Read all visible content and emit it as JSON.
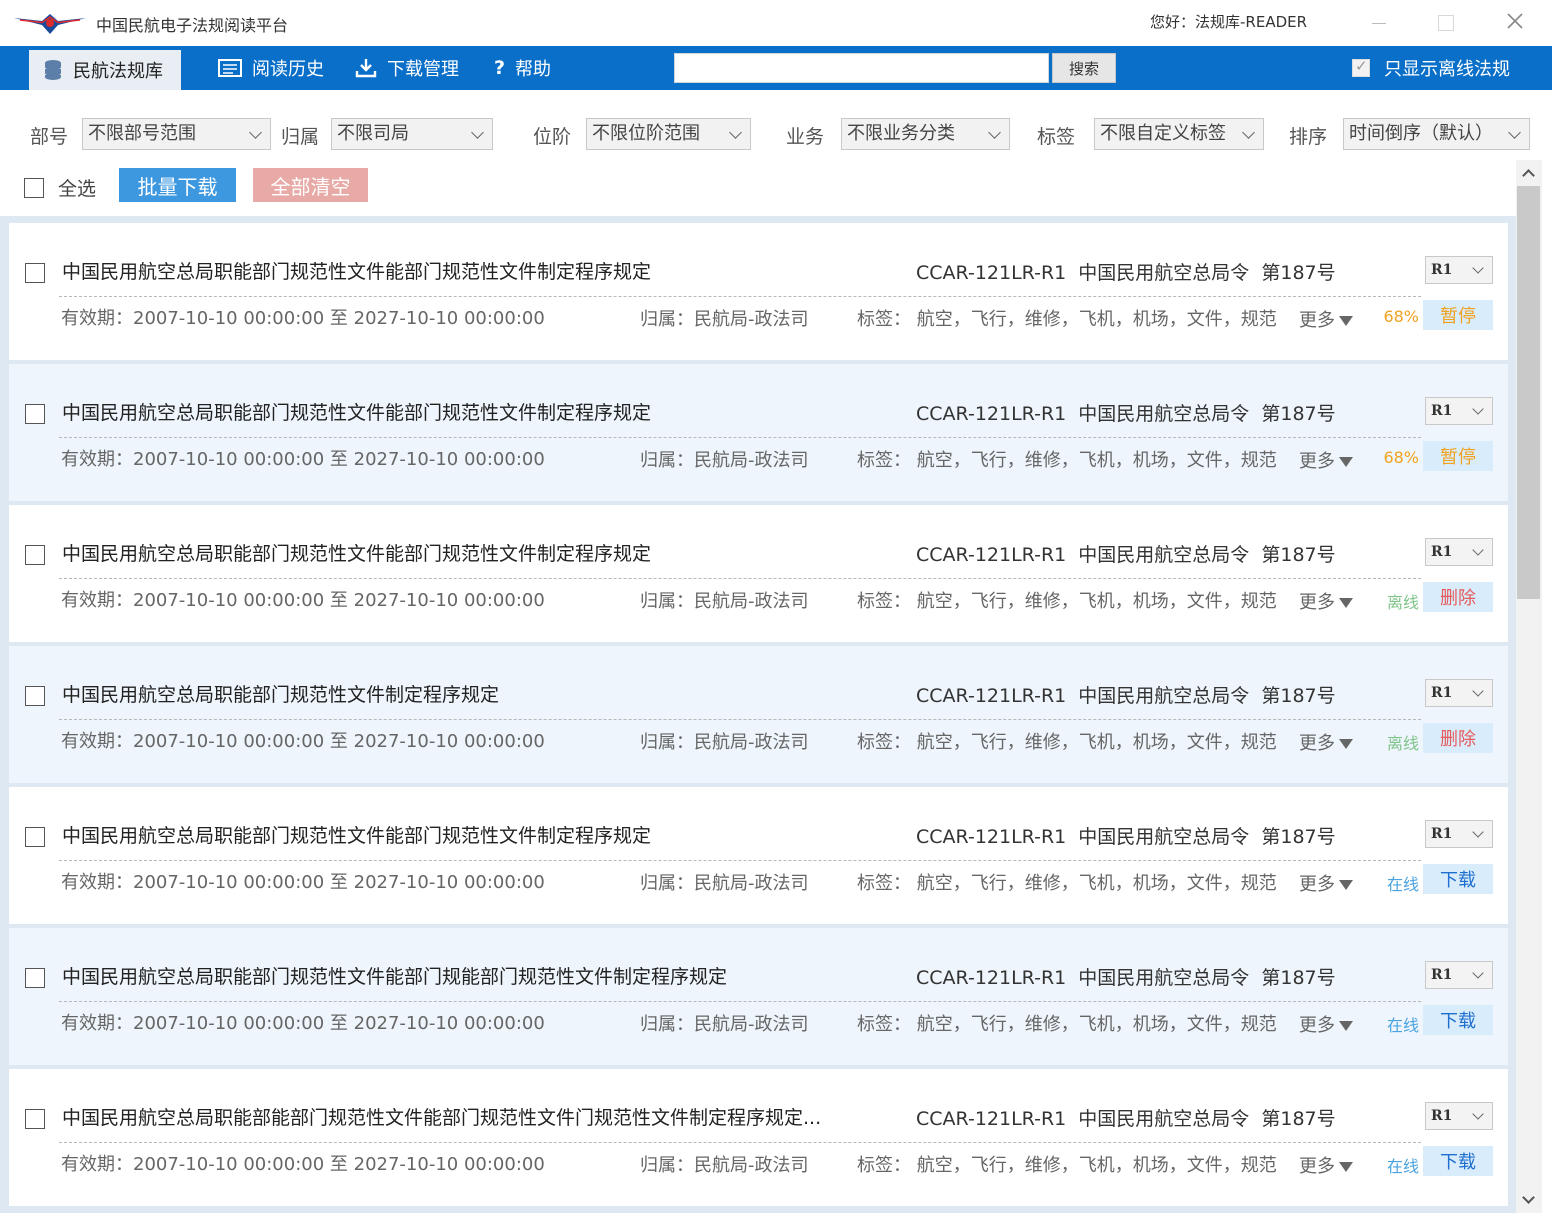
{
  "app": {
    "title": "中国民航电子法规阅读平台",
    "greeting": "您好：法规库-READER"
  },
  "nav": {
    "items": [
      {
        "label": "民航法规库",
        "icon": "database-icon",
        "active": true
      },
      {
        "label": "阅读历史",
        "icon": "list-icon"
      },
      {
        "label": "下载管理",
        "icon": "download-icon"
      },
      {
        "label": "帮助",
        "icon": "help-icon"
      }
    ],
    "search": {
      "value": "",
      "placeholder": "",
      "button": "搜索"
    },
    "offline_toggle": {
      "label": "只显示离线法规",
      "checked": true
    }
  },
  "filters": {
    "department": {
      "label": "部号",
      "value": "不限部号范围"
    },
    "belong": {
      "label": "归属",
      "value": "不限司局"
    },
    "rank": {
      "label": "位阶",
      "value": "不限位阶范围"
    },
    "business": {
      "label": "业务",
      "value": "不限业务分类"
    },
    "tag": {
      "label": "标签",
      "value": "不限自定义标签"
    },
    "sort": {
      "label": "排序",
      "value": "时间倒序（默认）"
    }
  },
  "toolbar": {
    "select_all": "全选",
    "batch_download": "批量下载",
    "clear_all": "全部清空"
  },
  "colors": {
    "nav_blue": "#0a6fc8",
    "status_progress": "#f0a322",
    "status_offline": "#7fc48a",
    "status_online": "#4aa3df",
    "delete": "#e55a5a"
  },
  "rows": [
    {
      "title": "中国民用航空总局职能部门规范性文件能部门规范性文件制定程序规定",
      "code": "CCAR-121LR-R1",
      "issuer": "中国民用航空总局令",
      "number": "第187号",
      "validity": "有效期：2007-10-10 00:00:00 至 2027-10-10 00:00:00",
      "owner": "归属：民航局-政法司",
      "tags": "标签： 航空，飞行，维修，飞机，机场，文件，规范",
      "more": "更多",
      "version": "R1",
      "status": "68%",
      "action": "暂停"
    },
    {
      "title": "中国民用航空总局职能部门规范性文件能部门规范性文件制定程序规定",
      "code": "CCAR-121LR-R1",
      "issuer": "中国民用航空总局令",
      "number": "第187号",
      "validity": "有效期：2007-10-10 00:00:00 至 2027-10-10 00:00:00",
      "owner": "归属：民航局-政法司",
      "tags": "标签： 航空，飞行，维修，飞机，机场，文件，规范",
      "more": "更多",
      "version": "R1",
      "status": "68%",
      "action": "暂停"
    },
    {
      "title": "中国民用航空总局职能部门规范性文件能部门规范性文件制定程序规定",
      "code": "CCAR-121LR-R1",
      "issuer": "中国民用航空总局令",
      "number": "第187号",
      "validity": "有效期：2007-10-10 00:00:00 至 2027-10-10 00:00:00",
      "owner": "归属：民航局-政法司",
      "tags": "标签： 航空，飞行，维修，飞机，机场，文件，规范",
      "more": "更多",
      "version": "R1",
      "status": "离线",
      "action": "删除"
    },
    {
      "title": "中国民用航空总局职能部门规范性文件制定程序规定",
      "code": "CCAR-121LR-R1",
      "issuer": "中国民用航空总局令",
      "number": "第187号",
      "validity": "有效期：2007-10-10 00:00:00 至 2027-10-10 00:00:00",
      "owner": "归属：民航局-政法司",
      "tags": "标签： 航空，飞行，维修，飞机，机场，文件，规范",
      "more": "更多",
      "version": "R1",
      "status": "离线",
      "action": "删除"
    },
    {
      "title": "中国民用航空总局职能部门规范性文件能部门规范性文件制定程序规定",
      "code": "CCAR-121LR-R1",
      "issuer": "中国民用航空总局令",
      "number": "第187号",
      "validity": "有效期：2007-10-10 00:00:00 至 2027-10-10 00:00:00",
      "owner": "归属：民航局-政法司",
      "tags": "标签： 航空，飞行，维修，飞机，机场，文件，规范",
      "more": "更多",
      "version": "R1",
      "status": "在线",
      "action": "下载"
    },
    {
      "title": "中国民用航空总局职能部门规范性文件能部门规能部门规范性文件制定程序规定",
      "code": "CCAR-121LR-R1",
      "issuer": "中国民用航空总局令",
      "number": "第187号",
      "validity": "有效期：2007-10-10 00:00:00 至 2027-10-10 00:00:00",
      "owner": "归属：民航局-政法司",
      "tags": "标签： 航空，飞行，维修，飞机，机场，文件，规范",
      "more": "更多",
      "version": "R1",
      "status": "在线",
      "action": "下载"
    },
    {
      "title": "中国民用航空总局职能部能部门规范性文件能部门规范性文件门规范性文件制定程序规定...",
      "code": "CCAR-121LR-R1",
      "issuer": "中国民用航空总局令",
      "number": "第187号",
      "validity": "有效期：2007-10-10 00:00:00 至 2027-10-10 00:00:00",
      "owner": "归属：民航局-政法司",
      "tags": "标签： 航空，飞行，维修，飞机，机场，文件，规范",
      "more": "更多",
      "version": "R1",
      "status": "在线",
      "action": "下载"
    }
  ]
}
